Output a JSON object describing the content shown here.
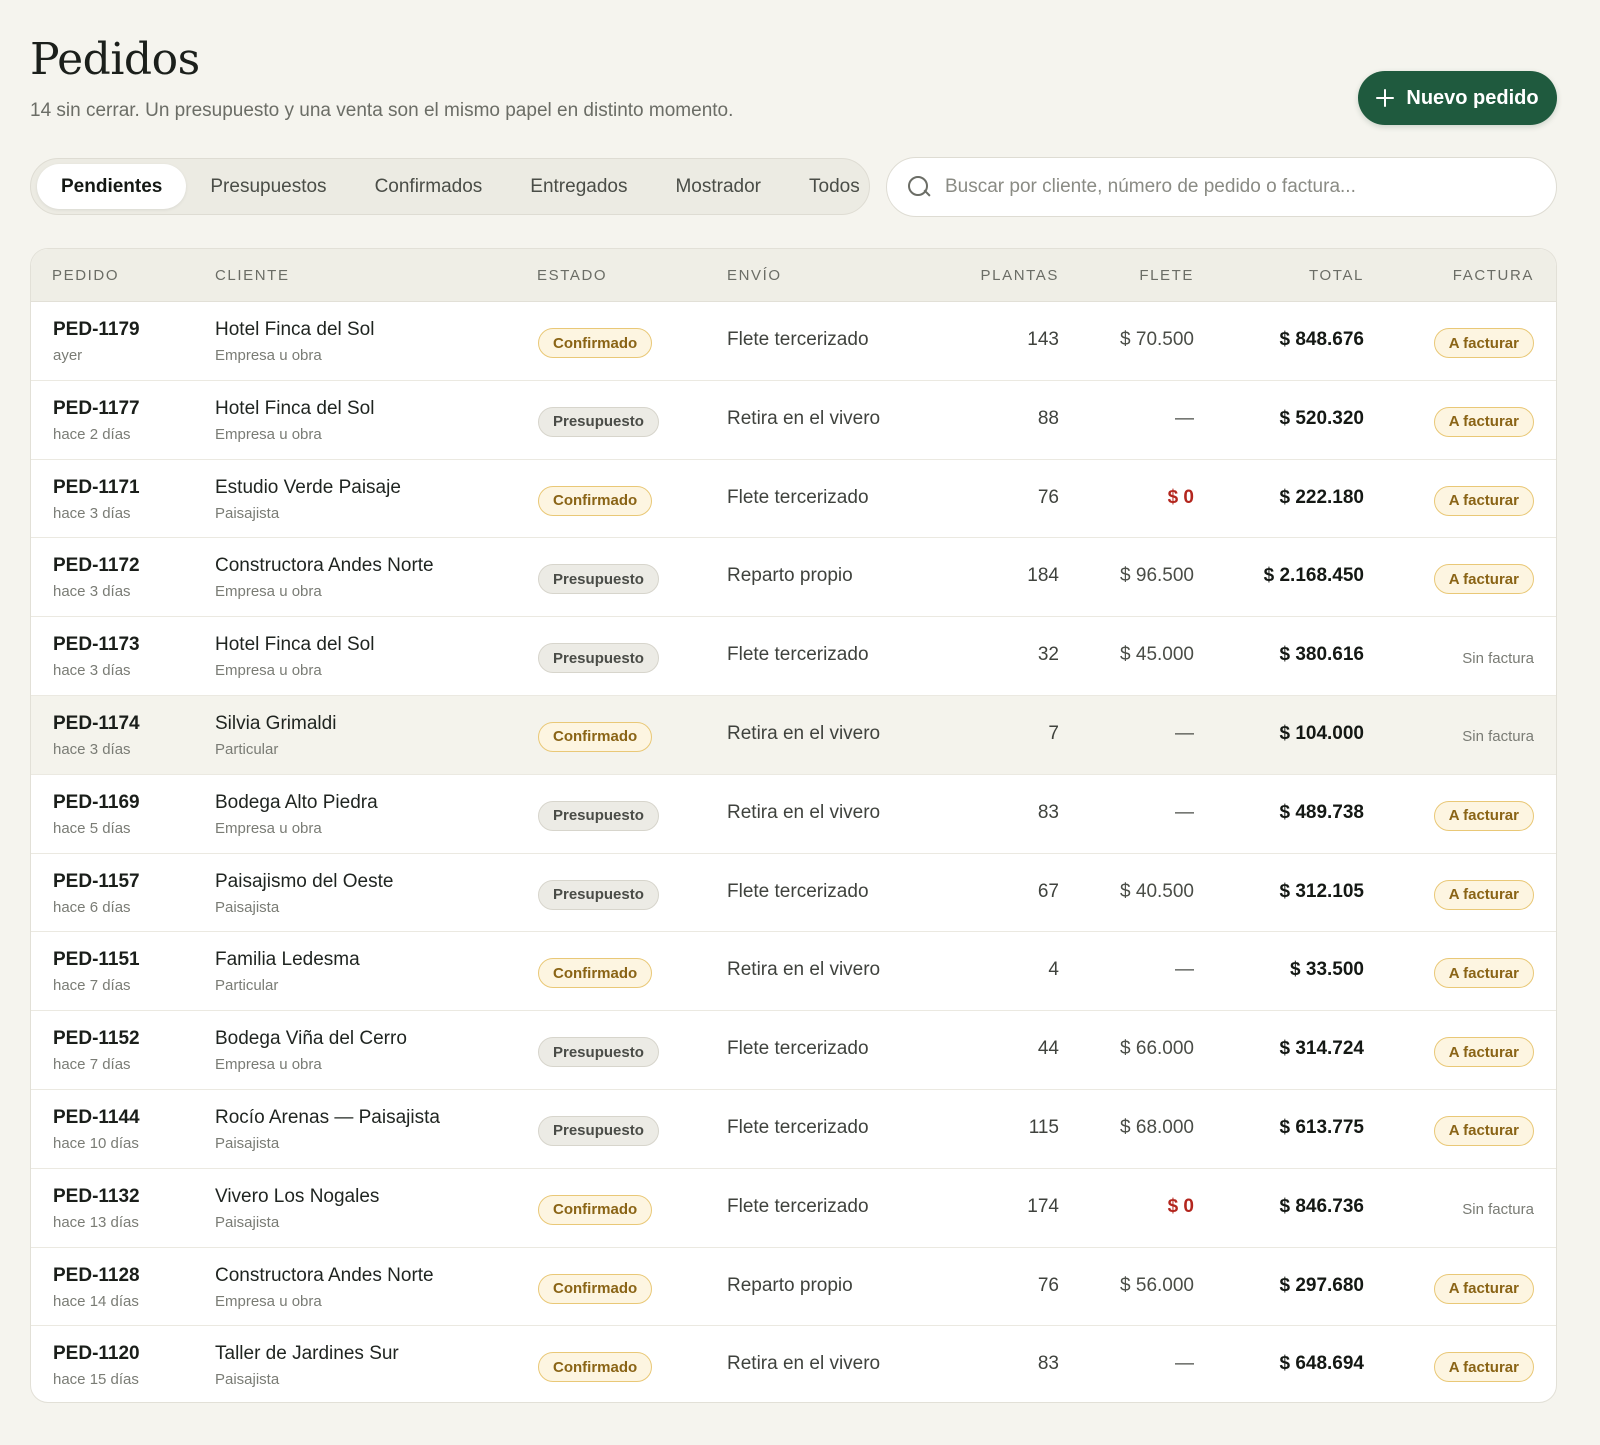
{
  "header": {
    "title": "Pedidos",
    "subtitle": "14 sin cerrar. Un presupuesto y una venta son el mismo papel en distinto momento.",
    "new_button": "Nuevo pedido"
  },
  "tabs": [
    {
      "label": "Pendientes",
      "active": true
    },
    {
      "label": "Presupuestos",
      "active": false
    },
    {
      "label": "Confirmados",
      "active": false
    },
    {
      "label": "Entregados",
      "active": false
    },
    {
      "label": "Mostrador",
      "active": false
    },
    {
      "label": "Todos",
      "active": false
    }
  ],
  "search": {
    "placeholder": "Buscar por cliente, número de pedido o factura...",
    "value": ""
  },
  "table": {
    "columns": [
      "PEDIDO",
      "CLIENTE",
      "ESTADO",
      "ENVÍO",
      "PLANTAS",
      "FLETE",
      "TOTAL",
      "FACTURA"
    ],
    "highlighted_row": 5,
    "rows": [
      {
        "id": "PED-1179",
        "when": "ayer",
        "client": "Hotel Finca del Sol",
        "client_type": "Empresa u obra",
        "status": "Confirmado",
        "envio": "Flete tercerizado",
        "plantas": "143",
        "flete": "$ 70.500",
        "total": "$ 848.676",
        "factura": "A facturar"
      },
      {
        "id": "PED-1177",
        "when": "hace 2 días",
        "client": "Hotel Finca del Sol",
        "client_type": "Empresa u obra",
        "status": "Presupuesto",
        "envio": "Retira en el vivero",
        "plantas": "88",
        "flete": "—",
        "total": "$ 520.320",
        "factura": "A facturar"
      },
      {
        "id": "PED-1171",
        "when": "hace 3 días",
        "client": "Estudio Verde Paisaje",
        "client_type": "Paisajista",
        "status": "Confirmado",
        "envio": "Flete tercerizado",
        "plantas": "76",
        "flete": "$ 0",
        "total": "$ 222.180",
        "factura": "A facturar"
      },
      {
        "id": "PED-1172",
        "when": "hace 3 días",
        "client": "Constructora Andes Norte",
        "client_type": "Empresa u obra",
        "status": "Presupuesto",
        "envio": "Reparto propio",
        "plantas": "184",
        "flete": "$ 96.500",
        "total": "$ 2.168.450",
        "factura": "A facturar"
      },
      {
        "id": "PED-1173",
        "when": "hace 3 días",
        "client": "Hotel Finca del Sol",
        "client_type": "Empresa u obra",
        "status": "Presupuesto",
        "envio": "Flete tercerizado",
        "plantas": "32",
        "flete": "$ 45.000",
        "total": "$ 380.616",
        "factura": "Sin factura"
      },
      {
        "id": "PED-1174",
        "when": "hace 3 días",
        "client": "Silvia Grimaldi",
        "client_type": "Particular",
        "status": "Confirmado",
        "envio": "Retira en el vivero",
        "plantas": "7",
        "flete": "—",
        "total": "$ 104.000",
        "factura": "Sin factura"
      },
      {
        "id": "PED-1169",
        "when": "hace 5 días",
        "client": "Bodega Alto Piedra",
        "client_type": "Empresa u obra",
        "status": "Presupuesto",
        "envio": "Retira en el vivero",
        "plantas": "83",
        "flete": "—",
        "total": "$ 489.738",
        "factura": "A facturar"
      },
      {
        "id": "PED-1157",
        "when": "hace 6 días",
        "client": "Paisajismo del Oeste",
        "client_type": "Paisajista",
        "status": "Presupuesto",
        "envio": "Flete tercerizado",
        "plantas": "67",
        "flete": "$ 40.500",
        "total": "$ 312.105",
        "factura": "A facturar"
      },
      {
        "id": "PED-1151",
        "when": "hace 7 días",
        "client": "Familia Ledesma",
        "client_type": "Particular",
        "status": "Confirmado",
        "envio": "Retira en el vivero",
        "plantas": "4",
        "flete": "—",
        "total": "$ 33.500",
        "factura": "A facturar"
      },
      {
        "id": "PED-1152",
        "when": "hace 7 días",
        "client": "Bodega Viña del Cerro",
        "client_type": "Empresa u obra",
        "status": "Presupuesto",
        "envio": "Flete tercerizado",
        "plantas": "44",
        "flete": "$ 66.000",
        "total": "$ 314.724",
        "factura": "A facturar"
      },
      {
        "id": "PED-1144",
        "when": "hace 10 días",
        "client": "Rocío Arenas — Paisajista",
        "client_type": "Paisajista",
        "status": "Presupuesto",
        "envio": "Flete tercerizado",
        "plantas": "115",
        "flete": "$ 68.000",
        "total": "$ 613.775",
        "factura": "A facturar"
      },
      {
        "id": "PED-1132",
        "when": "hace 13 días",
        "client": "Vivero Los Nogales",
        "client_type": "Paisajista",
        "status": "Confirmado",
        "envio": "Flete tercerizado",
        "plantas": "174",
        "flete": "$ 0",
        "total": "$ 846.736",
        "factura": "Sin factura"
      },
      {
        "id": "PED-1128",
        "when": "hace 14 días",
        "client": "Constructora Andes Norte",
        "client_type": "Empresa u obra",
        "status": "Confirmado",
        "envio": "Reparto propio",
        "plantas": "76",
        "flete": "$ 56.000",
        "total": "$ 297.680",
        "factura": "A facturar"
      },
      {
        "id": "PED-1120",
        "when": "hace 15 días",
        "client": "Taller de Jardines Sur",
        "client_type": "Paisajista",
        "status": "Confirmado",
        "envio": "Retira en el vivero",
        "plantas": "83",
        "flete": "—",
        "total": "$ 648.694",
        "factura": "A facturar"
      }
    ]
  },
  "colors": {
    "background": "#f5f4ee",
    "accent": "#1f5a3e",
    "confirmado": "#8a6416",
    "presupuesto": "#4a4c47",
    "zero_flete": "#b3261e"
  },
  "icons": {
    "new_button": "plus-icon",
    "search": "search-icon"
  }
}
